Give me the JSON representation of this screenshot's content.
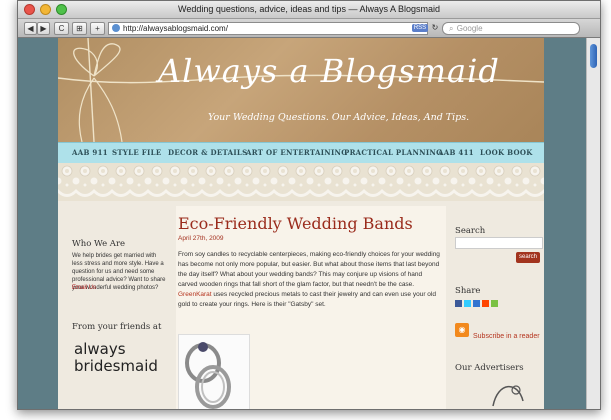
{
  "window": {
    "title": "Wedding questions, advice, ideas and tips — Always A Blogsmaid"
  },
  "toolbar": {
    "back_label": "◀",
    "forward_label": "▶",
    "reload_label": "C",
    "bookmark_label": "⊞",
    "add_label": "+",
    "url": "http://alwaysablogsmaid.com/",
    "rss_badge": "RSS",
    "search_placeholder": "Google"
  },
  "site": {
    "logo": "Always a Blogsmaid",
    "tagline": "Your Wedding Questions. Our Advice, Ideas, And Tips."
  },
  "nav": [
    {
      "label": "AAB 911"
    },
    {
      "label": "STYLE FILE"
    },
    {
      "label": "DECOR & DETAILS"
    },
    {
      "label": "ART OF ENTERTAINING"
    },
    {
      "label": "PRACTICAL PLANNING"
    },
    {
      "label": "AAB 411"
    },
    {
      "label": "LOOK BOOK"
    }
  ],
  "left": {
    "who_heading": "Who We Are",
    "who_text": "We help brides get married with less stress and more style. Have a question for us and need some professional advice? Want to share your wonderful wedding photos?",
    "email_link": "Email Us",
    "friends_heading": "From your friends at",
    "brand_line1": "always",
    "brand_line2": "bridesmaid"
  },
  "post": {
    "title": "Eco-Friendly Wedding Bands",
    "date": "April 27th, 2009",
    "body_before": "From soy candles to recyclable centerpieces, making eco-friendly choices for your wedding has become not only more popular, but easier. But what about those items that last beyond the day itself? What about your wedding bands? This may conjure up visions of hand carved wooden rings that fall short of the glam factor, but that needn't be the case. ",
    "body_link": "GreenKarat",
    "body_after": " uses recycled precious metals to cast their jewelry and can even use your old gold to create your rings. Here is their \"Gatsby\" set."
  },
  "right": {
    "search_heading": "Search",
    "search_button": "search",
    "share_heading": "Share",
    "subscribe_label": "Subscribe in a reader",
    "advertisers_heading": "Our Advertisers"
  },
  "colors": {
    "accent": "#9a2b1c",
    "nav_bg": "#aee1ea",
    "frame_bg": "#5e7d86"
  }
}
